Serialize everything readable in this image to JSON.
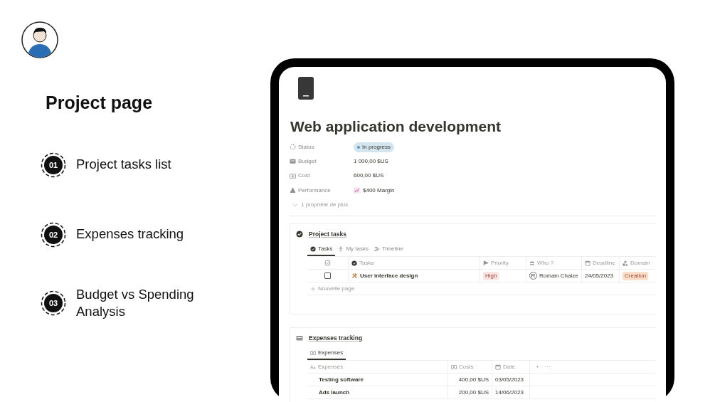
{
  "heading": "Project page",
  "features": [
    {
      "number": "01",
      "label": "Project tasks list"
    },
    {
      "number": "02",
      "label": "Expenses tracking"
    },
    {
      "number": "03",
      "label": "Budget vs Spending Analysis"
    }
  ],
  "page": {
    "title": "Web application development",
    "properties": [
      {
        "name": "Status",
        "kind": "status",
        "value": "In progress"
      },
      {
        "name": "Budget",
        "kind": "text",
        "value": "1 000,00 $US"
      },
      {
        "name": "Cost",
        "kind": "text",
        "value": "600,00 $US"
      },
      {
        "name": "Performance",
        "kind": "chart",
        "value": "$400 Margin"
      }
    ],
    "more_properties": "1 propriété de plus",
    "sections": [
      {
        "title": "Project tasks",
        "views": [
          {
            "label": "Tasks",
            "selected": true
          },
          {
            "label": "My tasks",
            "selected": false
          },
          {
            "label": "Timeline",
            "selected": false
          }
        ],
        "columns": [
          {
            "kind": "checkbox"
          },
          {
            "kind": "title",
            "label": "Tasks"
          },
          {
            "kind": "select",
            "label": "Priority"
          },
          {
            "kind": "person",
            "label": "Who ?"
          },
          {
            "kind": "date",
            "label": "Deadline"
          },
          {
            "kind": "select",
            "label": "Domain"
          }
        ],
        "rows": [
          {
            "cells": [
              {
                "checked": false
              },
              {
                "text": "User interface design"
              },
              {
                "text": "High",
                "color": "#fbe4e4"
              },
              {
                "initial": "R",
                "text": "Romain Chaize"
              },
              {
                "text": "24/05/2023"
              },
              {
                "text": "Creation",
                "color": "#fadec9"
              }
            ]
          }
        ],
        "new_row": "Nouvelle page"
      },
      {
        "title": "Expenses tracking",
        "views": [
          {
            "label": "Expenses",
            "selected": true
          }
        ],
        "columns": [
          {
            "kind": "title",
            "label": "Expenses"
          },
          {
            "kind": "number",
            "label": "Costs"
          },
          {
            "kind": "date",
            "label": "Date"
          },
          {
            "kind": "actions",
            "add": "+",
            "more": "···"
          }
        ],
        "rows": [
          {
            "cells": [
              {
                "text": "Testing software"
              },
              {
                "text": "400,00 $US"
              },
              {
                "text": "03/05/2023"
              },
              {}
            ]
          },
          {
            "cells": [
              {
                "text": "Ads launch"
              },
              {
                "text": "200,00 $US"
              },
              {
                "text": "14/06/2023"
              },
              {}
            ]
          }
        ]
      }
    ]
  }
}
